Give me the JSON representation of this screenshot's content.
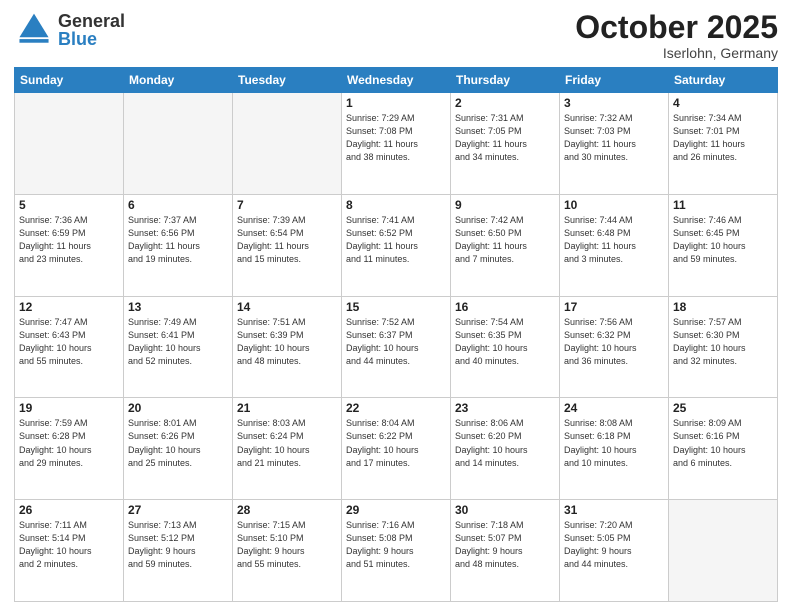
{
  "header": {
    "logo_general": "General",
    "logo_blue": "Blue",
    "month_title": "October 2025",
    "location": "Iserlohn, Germany"
  },
  "calendar": {
    "days_of_week": [
      "Sunday",
      "Monday",
      "Tuesday",
      "Wednesday",
      "Thursday",
      "Friday",
      "Saturday"
    ],
    "weeks": [
      [
        {
          "day": "",
          "info": ""
        },
        {
          "day": "",
          "info": ""
        },
        {
          "day": "",
          "info": ""
        },
        {
          "day": "1",
          "info": "Sunrise: 7:29 AM\nSunset: 7:08 PM\nDaylight: 11 hours\nand 38 minutes."
        },
        {
          "day": "2",
          "info": "Sunrise: 7:31 AM\nSunset: 7:05 PM\nDaylight: 11 hours\nand 34 minutes."
        },
        {
          "day": "3",
          "info": "Sunrise: 7:32 AM\nSunset: 7:03 PM\nDaylight: 11 hours\nand 30 minutes."
        },
        {
          "day": "4",
          "info": "Sunrise: 7:34 AM\nSunset: 7:01 PM\nDaylight: 11 hours\nand 26 minutes."
        }
      ],
      [
        {
          "day": "5",
          "info": "Sunrise: 7:36 AM\nSunset: 6:59 PM\nDaylight: 11 hours\nand 23 minutes."
        },
        {
          "day": "6",
          "info": "Sunrise: 7:37 AM\nSunset: 6:56 PM\nDaylight: 11 hours\nand 19 minutes."
        },
        {
          "day": "7",
          "info": "Sunrise: 7:39 AM\nSunset: 6:54 PM\nDaylight: 11 hours\nand 15 minutes."
        },
        {
          "day": "8",
          "info": "Sunrise: 7:41 AM\nSunset: 6:52 PM\nDaylight: 11 hours\nand 11 minutes."
        },
        {
          "day": "9",
          "info": "Sunrise: 7:42 AM\nSunset: 6:50 PM\nDaylight: 11 hours\nand 7 minutes."
        },
        {
          "day": "10",
          "info": "Sunrise: 7:44 AM\nSunset: 6:48 PM\nDaylight: 11 hours\nand 3 minutes."
        },
        {
          "day": "11",
          "info": "Sunrise: 7:46 AM\nSunset: 6:45 PM\nDaylight: 10 hours\nand 59 minutes."
        }
      ],
      [
        {
          "day": "12",
          "info": "Sunrise: 7:47 AM\nSunset: 6:43 PM\nDaylight: 10 hours\nand 55 minutes."
        },
        {
          "day": "13",
          "info": "Sunrise: 7:49 AM\nSunset: 6:41 PM\nDaylight: 10 hours\nand 52 minutes."
        },
        {
          "day": "14",
          "info": "Sunrise: 7:51 AM\nSunset: 6:39 PM\nDaylight: 10 hours\nand 48 minutes."
        },
        {
          "day": "15",
          "info": "Sunrise: 7:52 AM\nSunset: 6:37 PM\nDaylight: 10 hours\nand 44 minutes."
        },
        {
          "day": "16",
          "info": "Sunrise: 7:54 AM\nSunset: 6:35 PM\nDaylight: 10 hours\nand 40 minutes."
        },
        {
          "day": "17",
          "info": "Sunrise: 7:56 AM\nSunset: 6:32 PM\nDaylight: 10 hours\nand 36 minutes."
        },
        {
          "day": "18",
          "info": "Sunrise: 7:57 AM\nSunset: 6:30 PM\nDaylight: 10 hours\nand 32 minutes."
        }
      ],
      [
        {
          "day": "19",
          "info": "Sunrise: 7:59 AM\nSunset: 6:28 PM\nDaylight: 10 hours\nand 29 minutes."
        },
        {
          "day": "20",
          "info": "Sunrise: 8:01 AM\nSunset: 6:26 PM\nDaylight: 10 hours\nand 25 minutes."
        },
        {
          "day": "21",
          "info": "Sunrise: 8:03 AM\nSunset: 6:24 PM\nDaylight: 10 hours\nand 21 minutes."
        },
        {
          "day": "22",
          "info": "Sunrise: 8:04 AM\nSunset: 6:22 PM\nDaylight: 10 hours\nand 17 minutes."
        },
        {
          "day": "23",
          "info": "Sunrise: 8:06 AM\nSunset: 6:20 PM\nDaylight: 10 hours\nand 14 minutes."
        },
        {
          "day": "24",
          "info": "Sunrise: 8:08 AM\nSunset: 6:18 PM\nDaylight: 10 hours\nand 10 minutes."
        },
        {
          "day": "25",
          "info": "Sunrise: 8:09 AM\nSunset: 6:16 PM\nDaylight: 10 hours\nand 6 minutes."
        }
      ],
      [
        {
          "day": "26",
          "info": "Sunrise: 7:11 AM\nSunset: 5:14 PM\nDaylight: 10 hours\nand 2 minutes."
        },
        {
          "day": "27",
          "info": "Sunrise: 7:13 AM\nSunset: 5:12 PM\nDaylight: 9 hours\nand 59 minutes."
        },
        {
          "day": "28",
          "info": "Sunrise: 7:15 AM\nSunset: 5:10 PM\nDaylight: 9 hours\nand 55 minutes."
        },
        {
          "day": "29",
          "info": "Sunrise: 7:16 AM\nSunset: 5:08 PM\nDaylight: 9 hours\nand 51 minutes."
        },
        {
          "day": "30",
          "info": "Sunrise: 7:18 AM\nSunset: 5:07 PM\nDaylight: 9 hours\nand 48 minutes."
        },
        {
          "day": "31",
          "info": "Sunrise: 7:20 AM\nSunset: 5:05 PM\nDaylight: 9 hours\nand 44 minutes."
        },
        {
          "day": "",
          "info": ""
        }
      ]
    ]
  }
}
